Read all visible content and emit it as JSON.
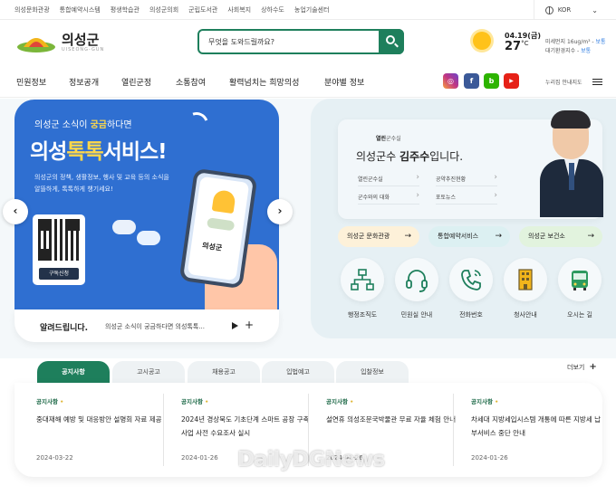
{
  "topbar": {
    "links": [
      "의성문화관광",
      "통합예약시스템",
      "평생학습관",
      "의성군의회",
      "군립도서관",
      "사회복지",
      "상하수도",
      "농업기술센터"
    ],
    "language": "KOR"
  },
  "header": {
    "logo_title": "의성군",
    "logo_sub": "UISEONG-GUN",
    "search_placeholder": "무엇을 도와드릴까요?"
  },
  "weather": {
    "date": "04.19(금)",
    "temp": "27",
    "unit": "°C",
    "fine_dust": "미세먼지 16ug/m³ -",
    "fine_dust_status": "보통",
    "air_index": "대기환경지수 -",
    "air_index_status": "보통"
  },
  "nav": {
    "items": [
      "민원정보",
      "정보공개",
      "열린군정",
      "소통참여",
      "활력넘치는 희망의성",
      "분야별 정보"
    ],
    "sitemap": "누리집 안내지도",
    "social": [
      {
        "name": "instagram",
        "color": "#c13584"
      },
      {
        "name": "facebook",
        "color": "#3b5998",
        "glyph": "f"
      },
      {
        "name": "blog",
        "color": "#2db400",
        "glyph": "b"
      },
      {
        "name": "youtube",
        "color": "#e62117",
        "glyph": "▶"
      }
    ]
  },
  "banner": {
    "line1_a": "의성군 소식",
    "line1_b": "이 ",
    "line1_c": "궁금",
    "line1_d": "하다면",
    "title_a": "의성",
    "title_b": "톡톡",
    "title_c": "서비스!",
    "desc": "의성군의 정책, 생활정보, 행사 및 교육 등의 소식을 알뜰하게, 톡톡하게 챙기세요!",
    "qr_label": "구독신청",
    "phone_logo": "의성군"
  },
  "notice_strip": {
    "title": "알려드립니다.",
    "message": "의성군 소식이 궁금하다면 의성톡톡..."
  },
  "mayor": {
    "tag_prefix": "열린",
    "tag_suffix": "군수실",
    "headline_a": "의성군수 ",
    "headline_name": "김주수",
    "headline_b": "입니다.",
    "links": [
      "열린군수실",
      "공약추진현황",
      "군수와의 대화",
      "포토뉴스"
    ]
  },
  "quick_pills": [
    {
      "label": "의성군 문화관광",
      "color": "#fdf1d9"
    },
    {
      "label": "통합예약서비스",
      "color": "#dcf0f2"
    },
    {
      "label": "의성군 보건소",
      "color": "#e2f3de"
    }
  ],
  "quick_icons": [
    {
      "label": "행정조직도",
      "icon": "org-chart-icon"
    },
    {
      "label": "민원실 안내",
      "icon": "headset-icon"
    },
    {
      "label": "전화번호",
      "icon": "phone-icon"
    },
    {
      "label": "청사안내",
      "icon": "building-icon"
    },
    {
      "label": "오시는 길",
      "icon": "bus-icon"
    }
  ],
  "board": {
    "tabs": [
      "공지사항",
      "고시공고",
      "채용공고",
      "입법예고",
      "입찰정보"
    ],
    "more": "더보기",
    "posts": [
      {
        "category": "공지사항",
        "title": "중대재해 예방 및 대응방안 설명회 자료 제공",
        "date": "2024-03-22"
      },
      {
        "category": "공지사항",
        "title": "2024년 경상북도 기초단계 스마트 공장 구축사업 사전 수요조사 실시",
        "date": "2024-01-26"
      },
      {
        "category": "공지사항",
        "title": "설연휴 의성조문국박물관 무료 자율 체험 안내",
        "date": "2024-01-26"
      },
      {
        "category": "공지사항",
        "title": "차세대 지방세입시스템 개통에 따른 지방세 납부서비스 중단 안내",
        "date": "2024-01-26"
      }
    ]
  },
  "watermark": "DailyDGNews"
}
